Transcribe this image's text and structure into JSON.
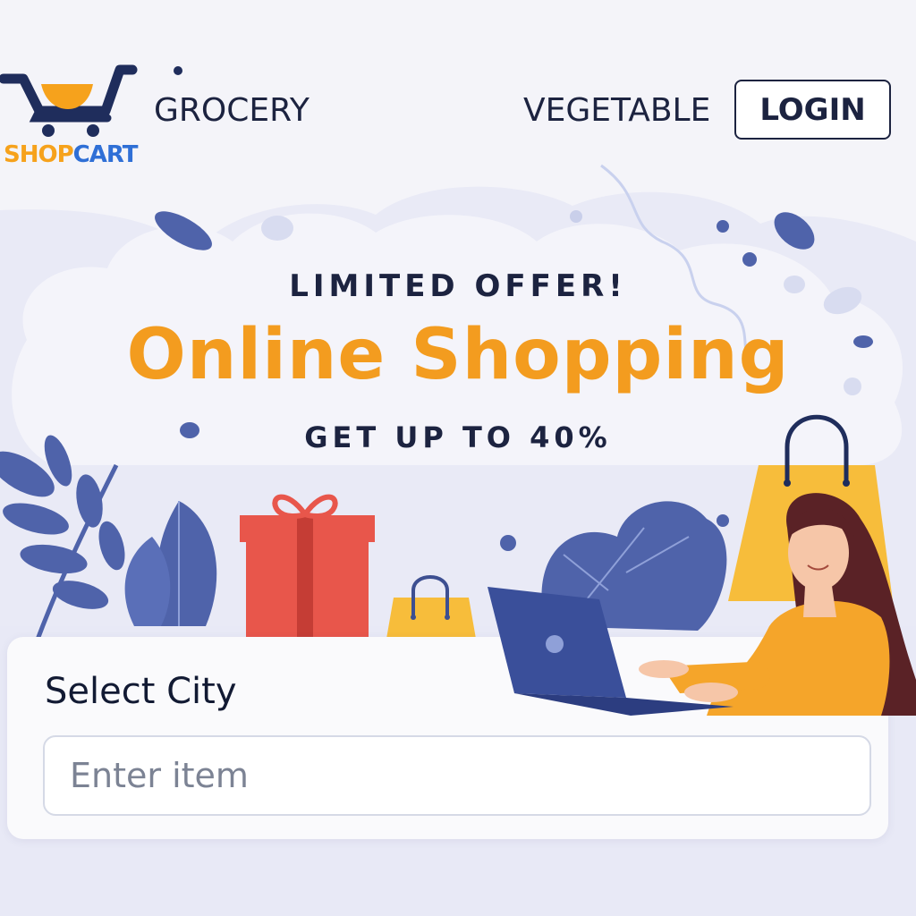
{
  "brand": {
    "logo_part1": "SHOP",
    "logo_part2": "CART",
    "colors": {
      "shop": "#f6a21c",
      "cart": "#2f6fd6",
      "cart_icon": "#1f2d5c"
    }
  },
  "nav": {
    "grocery": "GROCERY",
    "vegetable": "VEGETABLE",
    "login": "LOGIN"
  },
  "hero": {
    "kicker": "LIMITED OFFER!",
    "title": "Online Shopping",
    "subtitle": "GET UP TO 40%",
    "accent_color": "#f39c1f"
  },
  "search": {
    "label": "Select City",
    "placeholder": "Enter item",
    "value": ""
  },
  "icons": [
    "shopping-cart-logo-icon",
    "gift-box-icon",
    "shopping-bag-icon",
    "laptop-icon",
    "leaf-icon"
  ]
}
